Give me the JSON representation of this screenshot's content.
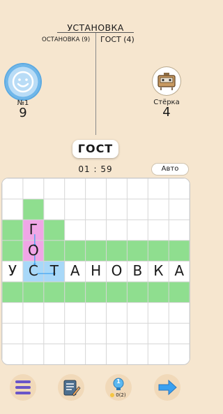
{
  "header": {
    "main_word": "УСТАНОВКА",
    "left_word": "ОСТАНОВКА (9)",
    "right_word": "ГОСТ (4)"
  },
  "player": {
    "label": "№1",
    "score": "9"
  },
  "opponent": {
    "label": "Стёрка",
    "score": "4"
  },
  "current_word": "ГОСТ",
  "timer": "01 : 59",
  "auto_label": "Авто",
  "board": {
    "row_letters": [
      "У",
      "С",
      "Т",
      "А",
      "Н",
      "О",
      "В",
      "К",
      "А"
    ],
    "col_letters": [
      "Г",
      "О"
    ]
  },
  "hint_count": "0(2)",
  "hint_badge": "1",
  "colors": {
    "background": "#f6e6cf",
    "grid": "#d6d6d6",
    "green_fill": "#8fde8f",
    "pink": "#f0a6e6",
    "blue": "#a8d8f8",
    "arrow": "#3aa0f0"
  }
}
